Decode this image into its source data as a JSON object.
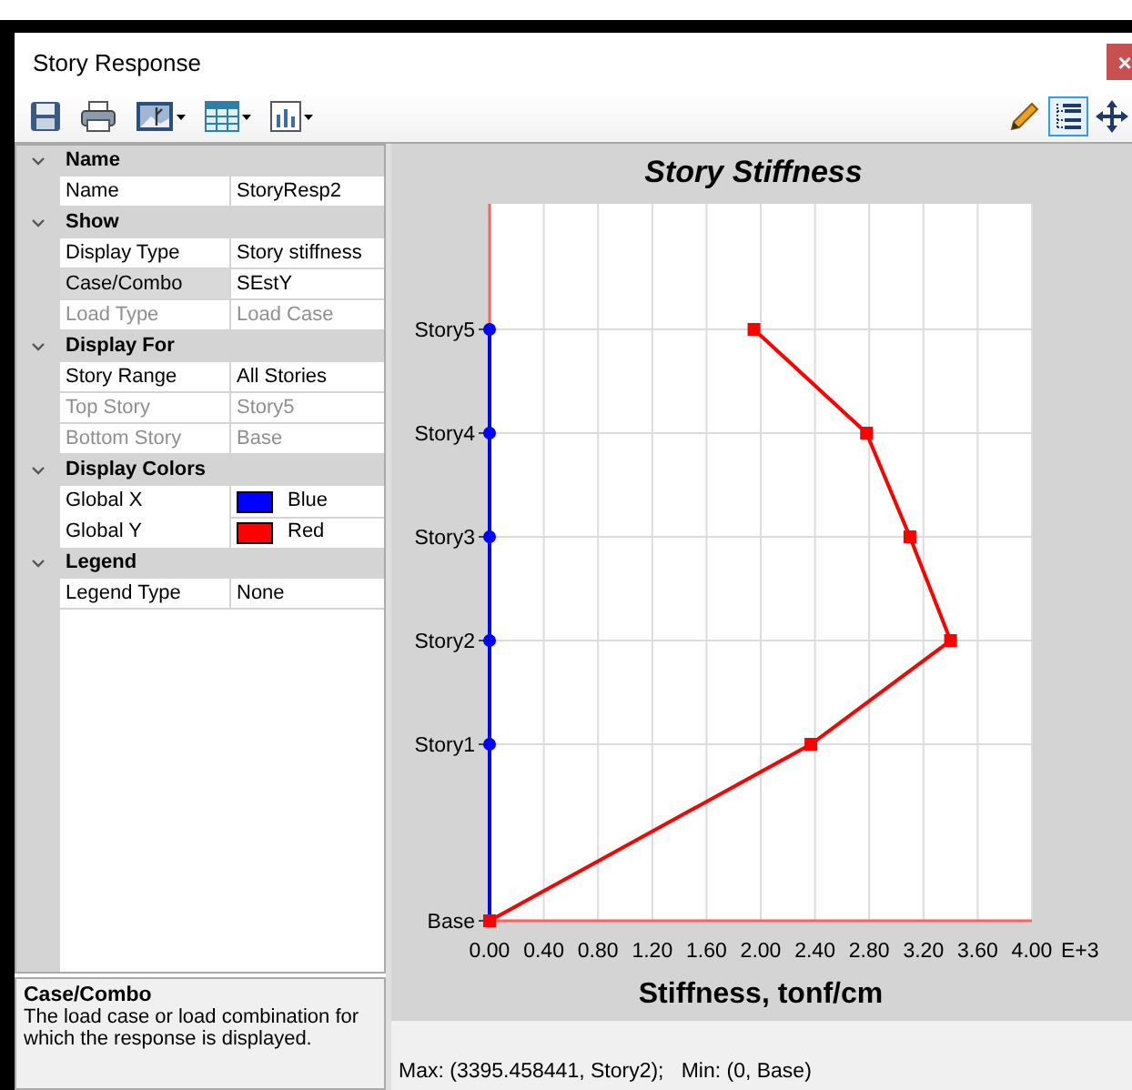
{
  "window": {
    "title": "Story Response",
    "close_glyph": "×"
  },
  "toolbar": {
    "left": [
      {
        "kind": "save",
        "dropdown": false
      },
      {
        "kind": "print",
        "dropdown": false
      },
      {
        "kind": "picture",
        "dropdown": true
      },
      {
        "kind": "table",
        "dropdown": true
      },
      {
        "kind": "chart",
        "dropdown": true
      }
    ],
    "right": [
      {
        "kind": "pencil",
        "selected": false
      },
      {
        "kind": "tree",
        "selected": true
      },
      {
        "kind": "move",
        "selected": false
      }
    ]
  },
  "property_grid": {
    "categories": [
      {
        "label": "Name",
        "expanded": true,
        "rows": [
          {
            "name": "Name",
            "value": "StoryResp2",
            "selected": false,
            "disabled": false
          }
        ]
      },
      {
        "label": "Show",
        "expanded": true,
        "rows": [
          {
            "name": "Display Type",
            "value": "Story stiffness",
            "selected": false,
            "disabled": false
          },
          {
            "name": "Case/Combo",
            "value": "SEstY",
            "selected": true,
            "disabled": false
          },
          {
            "name": "Load Type",
            "value": "Load Case",
            "selected": false,
            "disabled": true
          }
        ]
      },
      {
        "label": "Display For",
        "expanded": true,
        "rows": [
          {
            "name": "Story Range",
            "value": "All Stories",
            "selected": false,
            "disabled": false
          },
          {
            "name": "Top Story",
            "value": "Story5",
            "selected": false,
            "disabled": true
          },
          {
            "name": "Bottom Story",
            "value": "Base",
            "selected": false,
            "disabled": true
          }
        ]
      },
      {
        "label": "Display Colors",
        "expanded": true,
        "rows": [
          {
            "name": "Global X",
            "value": "Blue",
            "kind": "color",
            "color": "#0000ff",
            "selected": false,
            "disabled": false
          },
          {
            "name": "Global Y",
            "value": "Red",
            "kind": "color",
            "color": "#ff0000",
            "selected": false,
            "disabled": false
          }
        ]
      },
      {
        "label": "Legend",
        "expanded": true,
        "rows": [
          {
            "name": "Legend Type",
            "value": "None",
            "selected": false,
            "disabled": false
          }
        ]
      }
    ]
  },
  "description": {
    "title": "Case/Combo",
    "text": "The load case or load combination for which the response is displayed."
  },
  "chart": {
    "chart_data": {
      "type": "line",
      "orientation": "horizontal",
      "title": "Story Stiffness",
      "xlabel": "Stiffness, tonf/cm",
      "grid": true,
      "annotations": [
        {
          "text": "E+3"
        }
      ],
      "categories": [
        "Story5",
        "Story4",
        "Story3",
        "Story2",
        "Story1",
        "Base"
      ],
      "xlim": [
        0,
        4
      ],
      "xticks": [
        {
          "value": 0,
          "label": "0.00"
        },
        {
          "value": 0.4,
          "label": "0.40"
        },
        {
          "value": 0.8,
          "label": "0.80"
        },
        {
          "value": 1.2,
          "label": "1.20"
        },
        {
          "value": 1.6,
          "label": "1.60"
        },
        {
          "value": 2,
          "label": "2.00"
        },
        {
          "value": 2.4,
          "label": "2.40"
        },
        {
          "value": 2.8,
          "label": "2.80"
        },
        {
          "value": 3.2,
          "label": "3.20"
        },
        {
          "value": 3.6,
          "label": "3.60"
        },
        {
          "value": 4,
          "label": "4.00"
        }
      ],
      "series": [
        {
          "color": "#0000ff",
          "marker": "circle",
          "values": [
            0,
            0,
            0,
            0,
            0,
            0
          ]
        },
        {
          "color": "#ff0000",
          "marker": "square",
          "values": [
            1.95,
            2.78,
            3.1,
            3.4,
            2.37,
            0
          ]
        }
      ]
    }
  },
  "status_bar": {
    "text": "Max: (3395.458441, Story2);   Min: (0, Base)"
  }
}
